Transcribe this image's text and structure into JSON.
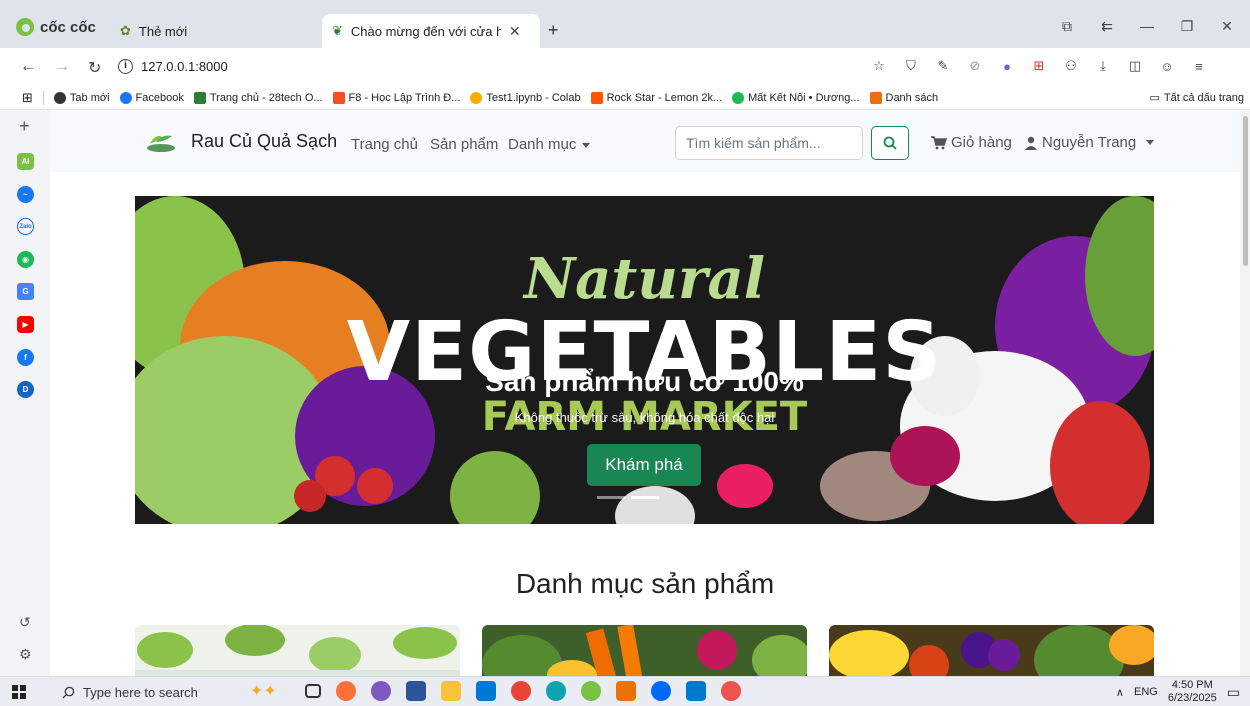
{
  "browser": {
    "brand": "cốc cốc",
    "tabs": [
      {
        "title": "Thẻ mới",
        "active": false
      },
      {
        "title": "Chào mừng đến với cửa hàng",
        "active": true
      }
    ],
    "url": "127.0.0.1:8000",
    "bookmarks": [
      {
        "label": "Tab mới",
        "color": "#333333"
      },
      {
        "label": "Facebook",
        "color": "#1877f2"
      },
      {
        "label": "Trang chủ - 28tech O...",
        "color": "#2e7d32"
      },
      {
        "label": "F8 - Học Lập Trình Đ...",
        "color": "#f05123"
      },
      {
        "label": "Test1.ipynb - Colab",
        "color": "#f9ab00"
      },
      {
        "label": "Rock Star - Lemon 2k...",
        "color": "#ff5500"
      },
      {
        "label": "Mất Kết Nối • Dương...",
        "color": "#1db954"
      },
      {
        "label": "Danh sách",
        "color": "#e8710a"
      }
    ],
    "all_bookmarks": "Tất cả dấu trang"
  },
  "site": {
    "title": "Rau Củ Quả Sạch",
    "nav": {
      "home": "Trang chủ",
      "products": "Sản phẩm",
      "categories": "Danh mục"
    },
    "search_placeholder": "Tìm kiếm sản phẩm...",
    "cart": "Giỏ hàng",
    "user": "Nguyễn Trang",
    "accent": "#198754"
  },
  "hero": {
    "natural": "Natural",
    "vegetables": "VEGETABLES",
    "farm": "FARM MARKET",
    "caption": "Sản phẩm hữu cơ 100%",
    "subcaption": "Không thuốc trừ sâu, không hóa chất độc hại",
    "button": "Khám phá"
  },
  "categories": {
    "title": "Danh mục sản phẩm"
  },
  "taskbar": {
    "search_placeholder": "Type here to search",
    "lang": "ENG",
    "time": "4:50 PM",
    "date": "6/23/2025"
  }
}
